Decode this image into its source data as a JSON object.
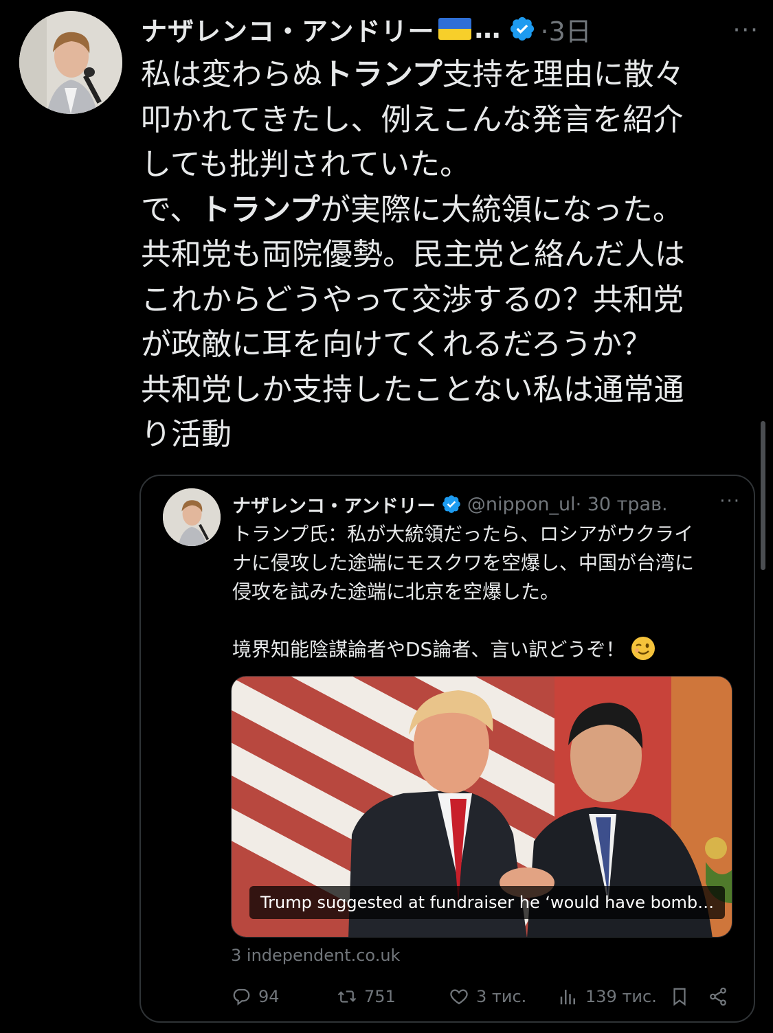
{
  "tweet": {
    "author_name": "ナザレンコ・アンドリー",
    "name_truncation": "…",
    "time": "·3日",
    "more_label": "···",
    "body_lines": [
      "私は変わらぬ",
      "トランプ",
      "支持を理由に散々\n叩かれてきたし、例えこんな発言を紹介\nしても批判されていた。\nで、",
      "トランプ",
      "が実際に大統領になった。\n共和党も両院優勢。民主党と絡んだ人は\nこれからどうやって交渉するの？共和党\nが政敵に耳を向けてくれるだろうか？\n共和党しか支持したことない私は通常通\nり活動"
    ]
  },
  "quote": {
    "author_name": "ナザレンコ・アンドリー",
    "handle": "@nippon_ul",
    "time": " · 30 трав.",
    "more_label": "···",
    "text": "トランプ氏：私が大統領だったら、ロシアがウクライ\nナに侵攻した途端にモスクワを空爆し、中国が台湾に\n侵攻を試みた途端に北京を空爆した。\n\n境界知能陰謀論者やDS論者、言い訳どうぞ！",
    "image_caption": "Trump suggested at fundraiser he ‘would have bomb…",
    "source": "3 independent.co.uk",
    "actions": {
      "replies": "94",
      "reposts": "751",
      "likes": "3 тис.",
      "views": "139 тис."
    }
  },
  "colors": {
    "background": "#000000",
    "text": "#e7e9ea",
    "muted": "#71767b",
    "verified": "#1d9bf0",
    "border": "#2f3336"
  },
  "icons": [
    "verified-badge-icon",
    "ukraine-flag-icon",
    "more-icon",
    "reply-icon",
    "repost-icon",
    "like-icon",
    "views-icon",
    "bookmark-icon",
    "share-icon",
    "wink-emoji-icon"
  ]
}
